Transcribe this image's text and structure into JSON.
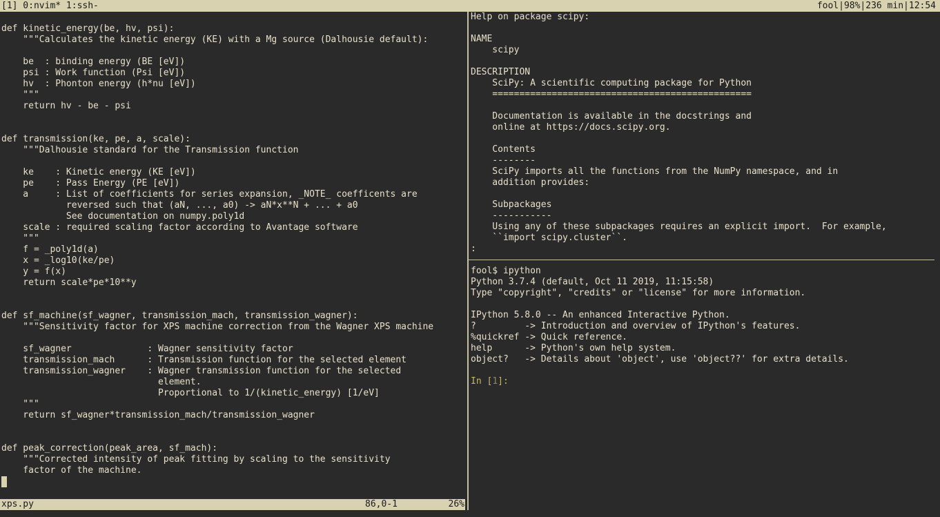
{
  "tmux": {
    "left": "[1] 0:nvim* 1:ssh-",
    "right": "fool|98%|236 min|12:54"
  },
  "editor": {
    "lines": [
      "def kinetic_energy(be, hv, psi):",
      "    \"\"\"Calculates the kinetic energy (KE) with a Mg source (Dalhousie default):",
      "",
      "    be  : binding energy (BE [eV])",
      "    psi : Work function (Psi [eV])",
      "    hv  : Phonton energy (h*nu [eV])",
      "    \"\"\"",
      "    return hv - be - psi",
      "",
      "",
      "def transmission(ke, pe, a, scale):",
      "    \"\"\"Dalhousie standard for the Transmission function",
      "",
      "    ke    : Kinetic energy (KE [eV])",
      "    pe    : Pass Energy (PE [eV])",
      "    a     : List of coefficients for series expansion, _NOTE_ coefficents are",
      "            reversed such that (aN, ..., a0) -> aN*x**N + ... + a0",
      "            See documentation on numpy.poly1d",
      "    scale : required scaling factor according to Avantage software",
      "    \"\"\"",
      "    f = _poly1d(a)",
      "    x = _log10(ke/pe)",
      "    y = f(x)",
      "    return scale*pe*10**y",
      "",
      "",
      "def sf_machine(sf_wagner, transmission_mach, transmission_wagner):",
      "    \"\"\"Sensitivity factor for XPS machine correction from the Wagner XPS machine",
      "",
      "    sf_wagner              : Wagner sensitivity factor",
      "    transmission_mach      : Transmission function for the selected element",
      "    transmission_wagner    : Wagner transmission function for the selected",
      "                             element.",
      "                             Proportional to 1/(kinetic_energy) [1/eV]",
      "    \"\"\"",
      "    return sf_wagner*transmission_mach/transmission_wagner",
      "",
      "",
      "def peak_correction(peak_area, sf_mach):",
      "    \"\"\"Corrected intensity of peak fitting by scaling to the sensitivity",
      "    factor of the machine."
    ],
    "status": {
      "filename": "xps.py",
      "position": "86,0-1",
      "percent": "26%"
    }
  },
  "help": {
    "lines": [
      "Help on package scipy:",
      "",
      "NAME",
      "    scipy",
      "",
      "DESCRIPTION",
      "    SciPy: A scientific computing package for Python",
      "    ================================================",
      "",
      "    Documentation is available in the docstrings and",
      "    online at https://docs.scipy.org.",
      "",
      "    Contents",
      "    --------",
      "    SciPy imports all the functions from the NumPy namespace, and in",
      "    addition provides:",
      "",
      "    Subpackages",
      "    -----------",
      "    Using any of these subpackages requires an explicit import.  For example,",
      "    ``import scipy.cluster``.",
      ":"
    ]
  },
  "ipython": {
    "lines": [
      "fool$ ipython",
      "Python 3.7.4 (default, Oct 11 2019, 11:15:58)",
      "Type \"copyright\", \"credits\" or \"license\" for more information.",
      "",
      "IPython 5.8.0 -- An enhanced Interactive Python.",
      "?         -> Introduction and overview of IPython's features.",
      "%quickref -> Quick reference.",
      "help      -> Python's own help system.",
      "object?   -> Details about 'object', use 'object??' for extra details.",
      ""
    ],
    "prompt_label": "In [",
    "prompt_number": "1",
    "prompt_end": "]:"
  }
}
